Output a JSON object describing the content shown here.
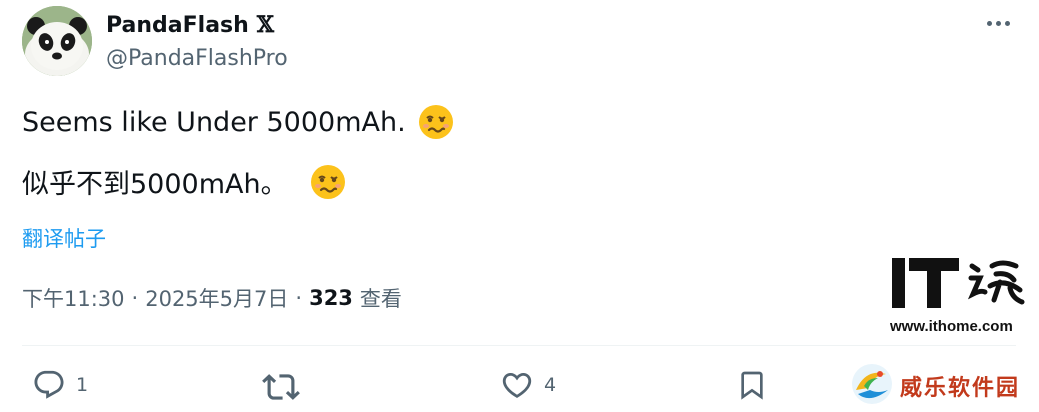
{
  "user": {
    "display_name": "PandaFlash",
    "x_mark": "𝕏",
    "handle": "@PandaFlashPro"
  },
  "tweet": {
    "line1": "Seems like Under 5000mAh.",
    "line2": "似乎不到5000mAh。",
    "emoji": "woozy-face-icon"
  },
  "translate_label": "翻译帖子",
  "meta": {
    "time": "下午11:30",
    "separator": "·",
    "date": "2025年5月7日",
    "views_count": "323",
    "views_label": "查看"
  },
  "actions": {
    "reply_count": "1",
    "retweet_count": "",
    "like_count": "4"
  },
  "watermarks": {
    "ithome_url": "www.ithome.com",
    "weile_text": "威乐软件园"
  },
  "colors": {
    "link": "#1d9bf0",
    "secondary_text": "#536471",
    "primary_text": "#0f1419",
    "divider": "#eff3f4"
  }
}
